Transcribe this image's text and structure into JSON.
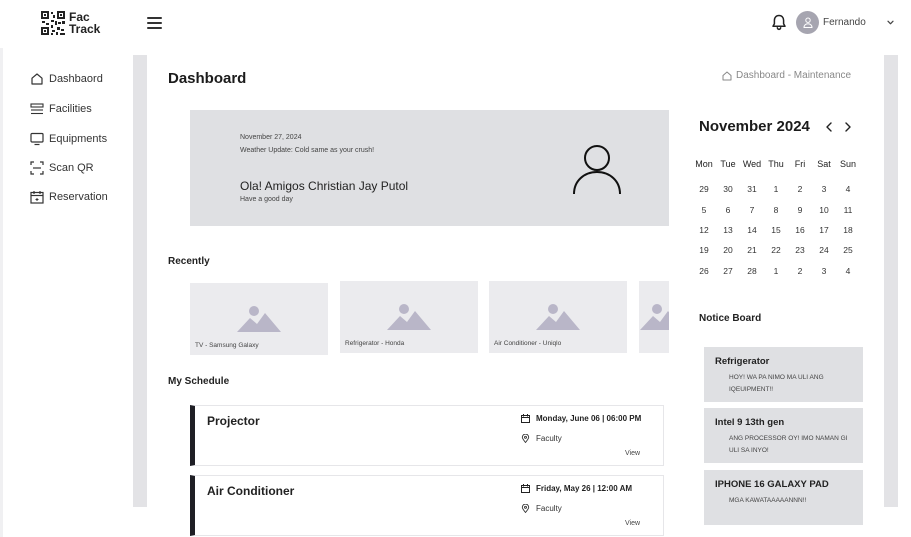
{
  "app": {
    "logo_line1": "Fac",
    "logo_line2": "Track"
  },
  "header": {
    "user_name": "Fernando",
    "icons": [
      "menu-icon",
      "bell-icon",
      "user-avatar-icon",
      "chevron-down-icon"
    ]
  },
  "sidebar": {
    "items": [
      {
        "label": "Dashbaord",
        "icon": "home-icon"
      },
      {
        "label": "Facilities",
        "icon": "facilities-icon"
      },
      {
        "label": "Equipments",
        "icon": "monitor-icon"
      },
      {
        "label": "Scan QR",
        "icon": "scan-icon"
      },
      {
        "label": "Reservation",
        "icon": "calendar-icon"
      }
    ]
  },
  "main": {
    "title": "Dashboard",
    "breadcrumb": "Dashboard - Maintenance"
  },
  "banner": {
    "date": "November 27, 2024",
    "weather": "Weather Update: Cold same as your crush!",
    "greeting": "Ola! Amigos Christian Jay Putol",
    "subtitle": "Have a good day"
  },
  "recently": {
    "title": "Recently",
    "items": [
      {
        "caption": "TV - Samsung Galaxy"
      },
      {
        "caption": "Refrigerator - Honda"
      },
      {
        "caption": "Air Conditioner - Uniqlo"
      },
      {
        "caption": ""
      }
    ]
  },
  "schedule": {
    "title": "My Schedule",
    "items": [
      {
        "name": "Projector",
        "when": "Monday, June 06 | 06:00 PM",
        "where": "Faculty",
        "action": "View"
      },
      {
        "name": "Air Conditioner",
        "when": "Friday, May 26 | 12:00 AM",
        "where": "Faculty",
        "action": "View"
      }
    ]
  },
  "calendar": {
    "month_label": "November 2024",
    "weekdays": [
      "Mon",
      "Tue",
      "Wed",
      "Thu",
      "Fri",
      "Sat",
      "Sun"
    ],
    "weeks": [
      [
        "29",
        "30",
        "31",
        "1",
        "2",
        "3",
        "4"
      ],
      [
        "5",
        "6",
        "7",
        "8",
        "9",
        "10",
        "11"
      ],
      [
        "12",
        "13",
        "14",
        "15",
        "16",
        "17",
        "18"
      ],
      [
        "19",
        "20",
        "21",
        "22",
        "23",
        "24",
        "25"
      ],
      [
        "26",
        "27",
        "28",
        "1",
        "2",
        "3",
        "4"
      ]
    ]
  },
  "notice_board": {
    "title": "Notice Board",
    "items": [
      {
        "title": "Refrigerator",
        "body": "HOY! WA PA NIMO MA ULI ANG IQEUIPMENT!!"
      },
      {
        "title": "Intel 9 13th gen",
        "body": "ANG PROCESSOR OY! IMO NAMAN GI ULI SA INYO!"
      },
      {
        "title": "IPHONE 16 GALAXY PAD",
        "body": "MGA KAWATAAAAANNN!!"
      }
    ]
  },
  "colors": {
    "banner_bg": "#dfe0e3",
    "frame_gray": "#e3e3e6",
    "placeholder_icon": "#b9b6c8",
    "accent_dark": "#1f1f25"
  }
}
